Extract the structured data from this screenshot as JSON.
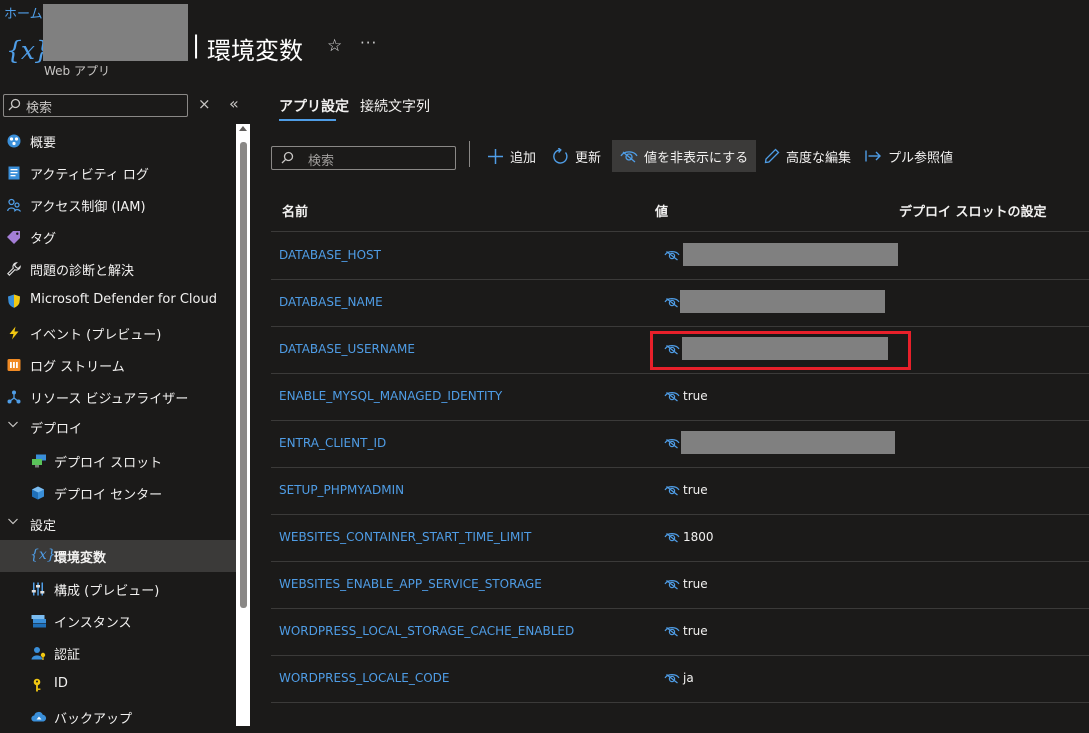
{
  "breadcrumb": "ホーム",
  "header": {
    "resource_icon": "{x}",
    "title_separator": "|",
    "title": "環境変数",
    "star_glyph": "☆",
    "more_glyph": "···",
    "subtitle": "Web アプリ"
  },
  "sidebar": {
    "search_placeholder": "検索",
    "clear_glyph": "×",
    "collapse_glyph": "«",
    "items": [
      {
        "label": "概要",
        "icon": "overview-icon"
      },
      {
        "label": "アクティビティ ログ",
        "icon": "activity-log-icon"
      },
      {
        "label": "アクセス制御 (IAM)",
        "icon": "iam-icon"
      },
      {
        "label": "タグ",
        "icon": "tag-icon"
      },
      {
        "label": "問題の診断と解決",
        "icon": "wrench-icon"
      },
      {
        "label": "Microsoft Defender for Cloud",
        "icon": "shield-icon"
      },
      {
        "label": "イベント (プレビュー)",
        "icon": "lightning-icon"
      },
      {
        "label": "ログ ストリーム",
        "icon": "log-stream-icon"
      },
      {
        "label": "リソース ビジュアライザー",
        "icon": "resource-visualizer-icon"
      },
      {
        "label": "デプロイ",
        "icon": "chevron-down-icon",
        "group": true
      },
      {
        "label": "デプロイ スロット",
        "icon": "deployment-slot-icon"
      },
      {
        "label": "デプロイ センター",
        "icon": "deployment-center-icon"
      },
      {
        "label": "設定",
        "icon": "chevron-down-icon",
        "group": true
      },
      {
        "label": "環境変数",
        "icon": "env-variable-icon",
        "active": true
      },
      {
        "label": "構成 (プレビュー)",
        "icon": "configuration-icon"
      },
      {
        "label": "インスタンス",
        "icon": "instances-icon"
      },
      {
        "label": "認証",
        "icon": "authentication-icon"
      },
      {
        "label": "ID",
        "icon": "identity-icon"
      },
      {
        "label": "バックアップ",
        "icon": "backup-icon"
      }
    ]
  },
  "tabs": [
    {
      "label": "アプリ設定",
      "active": true
    },
    {
      "label": "接続文字列",
      "active": false
    }
  ],
  "toolbar": {
    "search_placeholder": "検索",
    "add": "追加",
    "refresh": "更新",
    "hide_values": "値を非表示にする",
    "advanced_edit": "高度な編集",
    "pull_reference": "プル参照値"
  },
  "table": {
    "headers": {
      "name": "名前",
      "value": "値",
      "slot_setting": "デプロイ スロットの設定"
    },
    "rows": [
      {
        "name": "DATABASE_HOST",
        "value": "",
        "redacted": true
      },
      {
        "name": "DATABASE_NAME",
        "value": "",
        "redacted": true
      },
      {
        "name": "DATABASE_USERNAME",
        "value": "",
        "redacted": true,
        "highlighted": true
      },
      {
        "name": "ENABLE_MYSQL_MANAGED_IDENTITY",
        "value": "true"
      },
      {
        "name": "ENTRA_CLIENT_ID",
        "value": "",
        "redacted": true
      },
      {
        "name": "SETUP_PHPMYADMIN",
        "value": "true"
      },
      {
        "name": "WEBSITES_CONTAINER_START_TIME_LIMIT",
        "value": "1800"
      },
      {
        "name": "WEBSITES_ENABLE_APP_SERVICE_STORAGE",
        "value": "true"
      },
      {
        "name": "WORDPRESS_LOCAL_STORAGE_CACHE_ENABLED",
        "value": "true"
      },
      {
        "name": "WORDPRESS_LOCALE_CODE",
        "value": "ja"
      }
    ]
  },
  "colors": {
    "accent": "#4f9de6",
    "background": "#1b1a19",
    "highlight": "#e8202a",
    "redaction": "#808080"
  }
}
